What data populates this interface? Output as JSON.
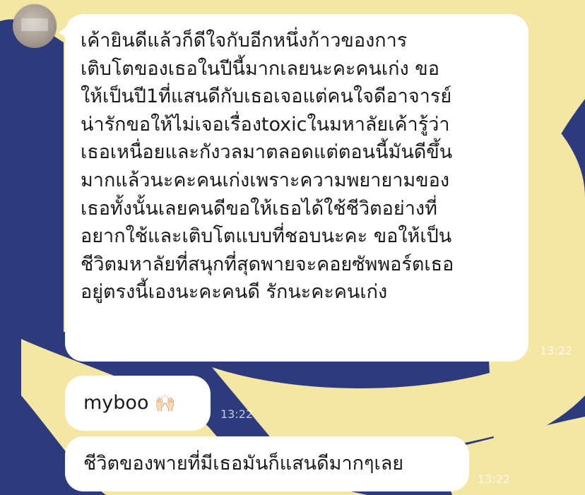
{
  "colors": {
    "background_navy": "#2d3b7d",
    "background_yellow": "#f4e7a4",
    "bubble": "#ffffff",
    "text": "#1b1b1b"
  },
  "messages": [
    {
      "text": "เค้ายินดีแล้วก็ดีใจกับอีกหนึ่งก้าวของการ\nเติบโตของเธอในปีนี้มากเลยนะคะคนเก่ง ขอ\nให้เป็นปี1ที่แสนดีกับเธอเจอแต่คนใจดีอาจารย์\nน่ารักขอให้ไม่เจอเรื่องtoxicในมหาลัยเค้ารู้ว่า\nเธอเหนื่อยและกังวลมาตลอดแต่ตอนนี้มันดีขึ้น\nมากแล้วนะคะคนเก่งเพราะความพยายามของ\nเธอทั้งนั้นเลยคนดีขอให้เธอได้ใช้ชีวิตอย่างที่\nอยากใช้และเติบโตแบบที่ชอบนะคะ ขอให้เป็น\nชีวิตมหาลัยที่สนุกที่สุดพายจะคอยซัพพอร์ตเธอ\nอยู่ตรงนี้เองนะคะคนดี รักนะคะคนเก่ง",
      "time": "13:22"
    },
    {
      "text": "myboo",
      "emoji": "🙌🏻",
      "emoji_name": "raising-hands-emoji",
      "time": "13:22"
    },
    {
      "text": "ชีวิตของพายที่มีเธอมันก็แสนดีมากๆเลย",
      "time": "13:22"
    }
  ]
}
